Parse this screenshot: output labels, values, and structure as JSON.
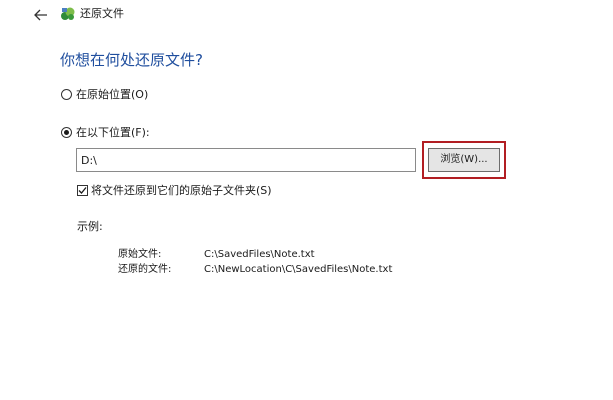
{
  "window": {
    "title": "还原文件"
  },
  "icons": {
    "back": "back-arrow-icon",
    "app": "file-history-icon"
  },
  "main": {
    "heading": "你想在何处还原文件?",
    "option_original": "在原始位置(O)",
    "option_custom": "在以下位置(F):",
    "selected_option": "option_custom",
    "path_value": "D:\\",
    "browse_label": "浏览(W)...",
    "subfolder_checkbox_label": "将文件还原到它们的原始子文件夹(S)",
    "subfolder_checked": true,
    "example_label": "示例:",
    "examples": [
      {
        "key": "原始文件:",
        "value": "C:\\SavedFiles\\Note.txt"
      },
      {
        "key": "还原的文件:",
        "value": "C:\\NewLocation\\C\\SavedFiles\\Note.txt"
      }
    ]
  },
  "colors": {
    "heading": "#1f4e9e",
    "highlight_border": "#b21e23",
    "button_bg": "#e5e5e5"
  }
}
